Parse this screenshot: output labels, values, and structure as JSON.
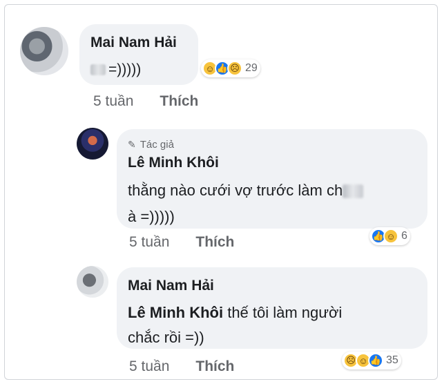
{
  "comments": [
    {
      "author": "Mai Nam Hải",
      "text": "=)))))",
      "reactions": {
        "icons": [
          "haha-icon",
          "like-icon",
          "sad-icon"
        ],
        "count": "29"
      },
      "time": "5 tuần",
      "like_label": "Thích"
    },
    {
      "author_badge": "Tác giả",
      "author": "Lê Minh Khôi",
      "text_line1": "thằng nào cưới vợ trước làm ch",
      "text_line2": "à =)))))",
      "reactions": {
        "icons": [
          "like-icon",
          "haha-icon"
        ],
        "count": "6"
      },
      "time": "5 tuần",
      "like_label": "Thích"
    },
    {
      "author": "Mai Nam Hải",
      "mention": "Lê Minh Khôi",
      "text_line1": " thế tôi làm người",
      "text_line2": "chắc rồi =))",
      "reactions": {
        "icons": [
          "sad-icon",
          "haha-icon",
          "like-icon"
        ],
        "count": "35"
      },
      "time": "5 tuần",
      "like_label": "Thích"
    }
  ],
  "colors": {
    "bubble": "#f0f2f5",
    "like_blue": "#1877f2",
    "emoji_yellow": "#f7c33c",
    "meta_gray": "#65676b"
  }
}
